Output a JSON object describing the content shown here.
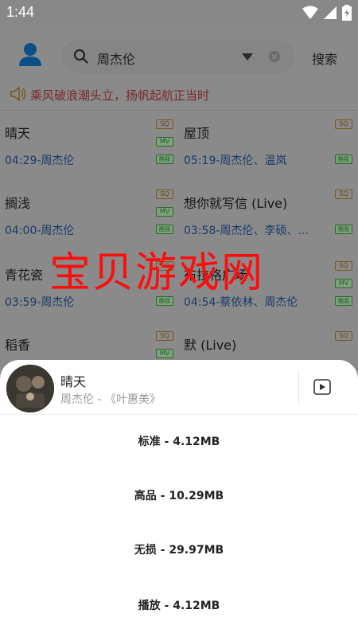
{
  "status_bar": {
    "time": "1:44"
  },
  "header": {
    "search_value": "周杰伦",
    "search_button": "搜索"
  },
  "notice": {
    "text": "乘风破浪潮头立，扬帆起航正当时"
  },
  "badges": {
    "sq": "SQ",
    "mv": "MV",
    "source": "酷我"
  },
  "songs": [
    {
      "title": "晴天",
      "duration": "04:29",
      "artist": "周杰伦",
      "sq": true,
      "mv": true
    },
    {
      "title": "屋顶",
      "duration": "05:19",
      "artist": "周杰伦、温岚",
      "sq": true,
      "mv": false
    },
    {
      "title": "搁浅",
      "duration": "04:00",
      "artist": "周杰伦",
      "sq": true,
      "mv": true
    },
    {
      "title": "想你就写信 (Live)",
      "duration": "03:58",
      "artist": "周杰伦、李硕、...",
      "sq": true,
      "mv": false
    },
    {
      "title": "青花瓷",
      "duration": "03:59",
      "artist": "周杰伦",
      "sq": true,
      "mv": false
    },
    {
      "title": "布拉格广场",
      "duration": "04:54",
      "artist": "蔡依林、周杰伦",
      "sq": true,
      "mv": true
    },
    {
      "title": "稻香",
      "duration": "",
      "artist": "",
      "sq": true,
      "mv": true
    },
    {
      "title": "默 (Live)",
      "duration": "",
      "artist": "",
      "sq": true,
      "mv": false
    }
  ],
  "separator": "-",
  "watermark": "宝贝游戏网",
  "sheet": {
    "song_title": "晴天",
    "subtitle": "周杰伦 - 《叶惠美》",
    "options": [
      "标准 - 4.12MB",
      "高品 - 10.29MB",
      "无损 - 29.97MB",
      "播放 - 4.12MB"
    ]
  },
  "colors": {
    "overlay_bg": "#8a8a8a",
    "link_blue": "#1a3b6a",
    "watermark_red": "#ff0d0d",
    "notice_red": "#7a2a2a"
  },
  "icons": [
    "user-icon",
    "search-icon",
    "dropdown-icon",
    "clear-icon",
    "speaker-icon",
    "wifi-icon",
    "signal-icon",
    "battery-icon",
    "play-video-icon"
  ]
}
